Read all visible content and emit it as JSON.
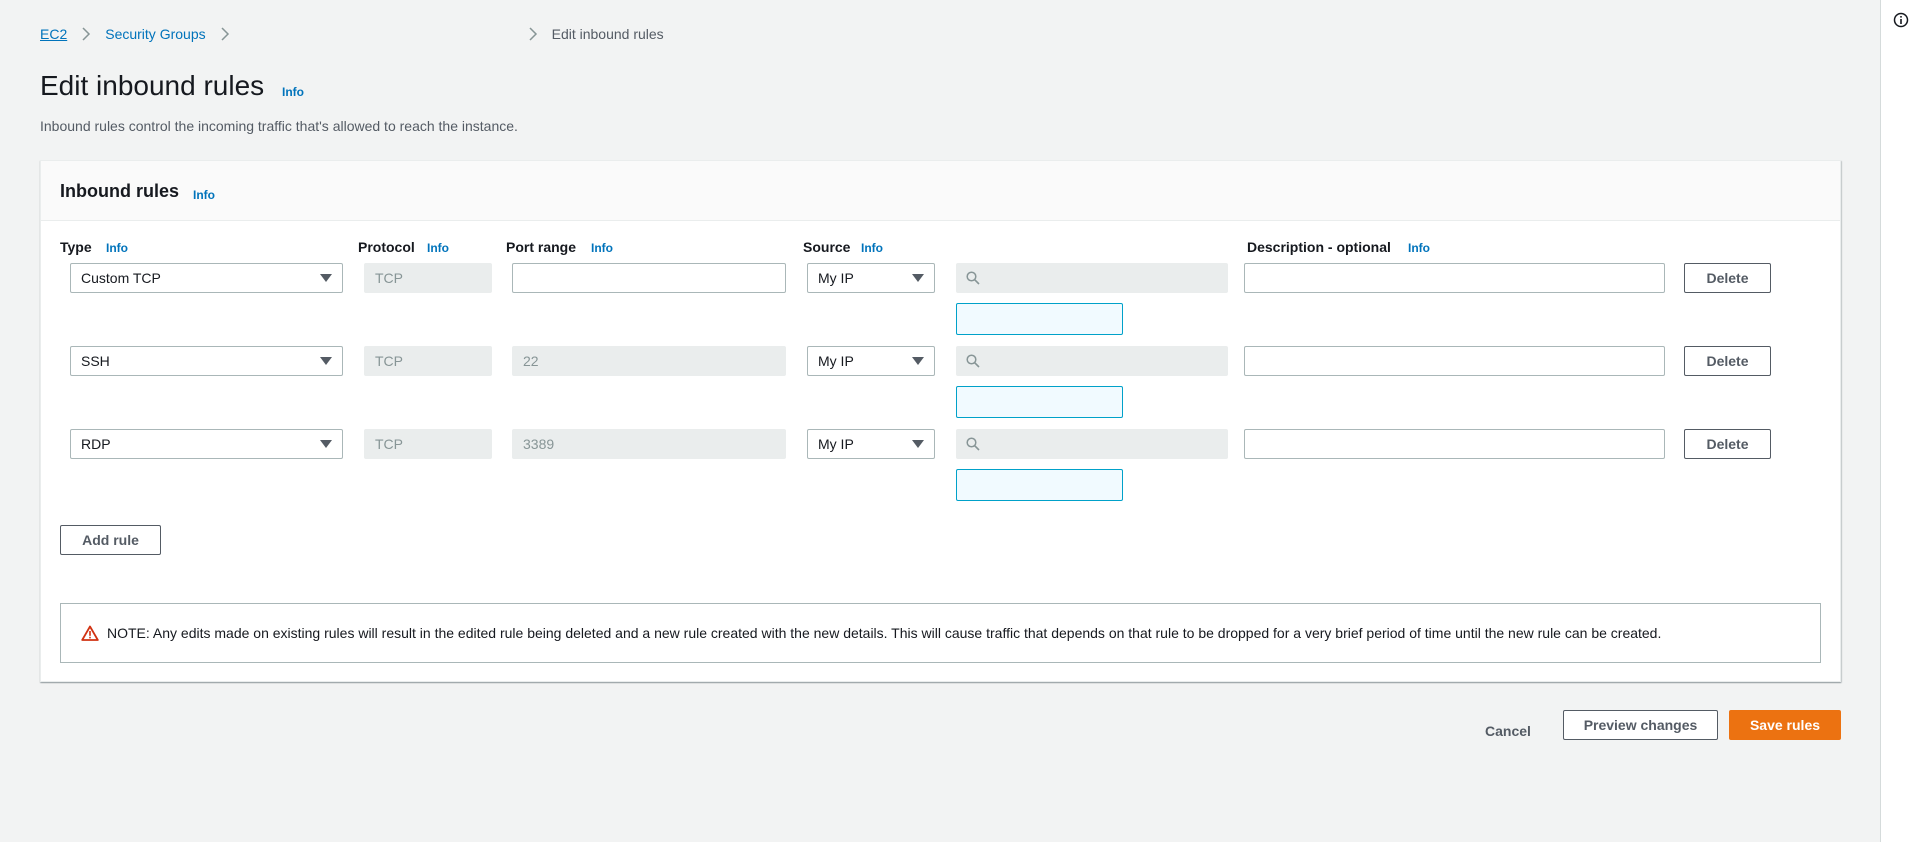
{
  "breadcrumb": {
    "ec2": "EC2",
    "security_groups": "Security Groups",
    "current": "Edit inbound rules"
  },
  "page": {
    "title": "Edit inbound rules",
    "info": "Info",
    "description": "Inbound rules control the incoming traffic that's allowed to reach the instance."
  },
  "panel": {
    "title": "Inbound rules",
    "info": "Info",
    "columns": {
      "type": "Type",
      "protocol": "Protocol",
      "port_range": "Port range",
      "source": "Source",
      "description": "Description - optional",
      "info": "Info"
    },
    "rows": [
      {
        "type": "Custom TCP",
        "protocol": "TCP",
        "port_range": "",
        "source": "My IP",
        "description": "",
        "delete": "Delete"
      },
      {
        "type": "SSH",
        "protocol": "TCP",
        "port_range": "22",
        "source": "My IP",
        "description": "",
        "delete": "Delete"
      },
      {
        "type": "RDP",
        "protocol": "TCP",
        "port_range": "3389",
        "source": "My IP",
        "description": "",
        "delete": "Delete"
      }
    ],
    "add_rule": "Add rule",
    "note": "NOTE: Any edits made on existing rules will result in the edited rule being deleted and a new rule created with the new details. This will cause traffic that depends on that rule to be dropped for a very brief period of time until the new rule can be created."
  },
  "footer": {
    "cancel": "Cancel",
    "preview": "Preview changes",
    "save": "Save rules"
  },
  "colors": {
    "link": "#0073bb",
    "primary": "#ec7211",
    "warning": "#d13212",
    "cidr_border": "#00a1c9"
  },
  "icons": {
    "side_info": "info-circle-icon",
    "search": "search-icon",
    "warning": "warning-triangle-icon",
    "breadcrumb_sep": "chevron-right-icon",
    "dropdown": "caret-down-icon"
  }
}
